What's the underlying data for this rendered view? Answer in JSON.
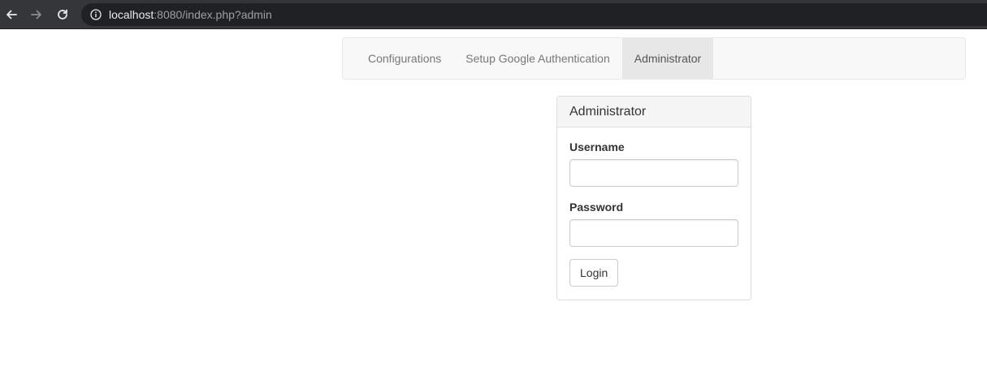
{
  "browser": {
    "url_host": "localhost",
    "url_rest": ":8080/index.php?admin",
    "icons": {
      "back": "arrow-left-icon",
      "forward": "arrow-right-icon",
      "reload": "reload-icon",
      "info": "info-icon"
    }
  },
  "navbar": {
    "tabs": [
      {
        "label": "Configurations",
        "active": false
      },
      {
        "label": "Setup Google Authentication",
        "active": false
      },
      {
        "label": "Administrator",
        "active": true
      }
    ]
  },
  "panel": {
    "title": "Administrator",
    "username_label": "Username",
    "username_value": "",
    "password_label": "Password",
    "password_value": "",
    "login_label": "Login"
  },
  "colors": {
    "browser_bg": "#35363a",
    "address_bg": "#202124",
    "navbar_bg": "#f8f8f8",
    "active_tab_bg": "#e7e7e7",
    "panel_heading_bg": "#f5f5f5"
  }
}
